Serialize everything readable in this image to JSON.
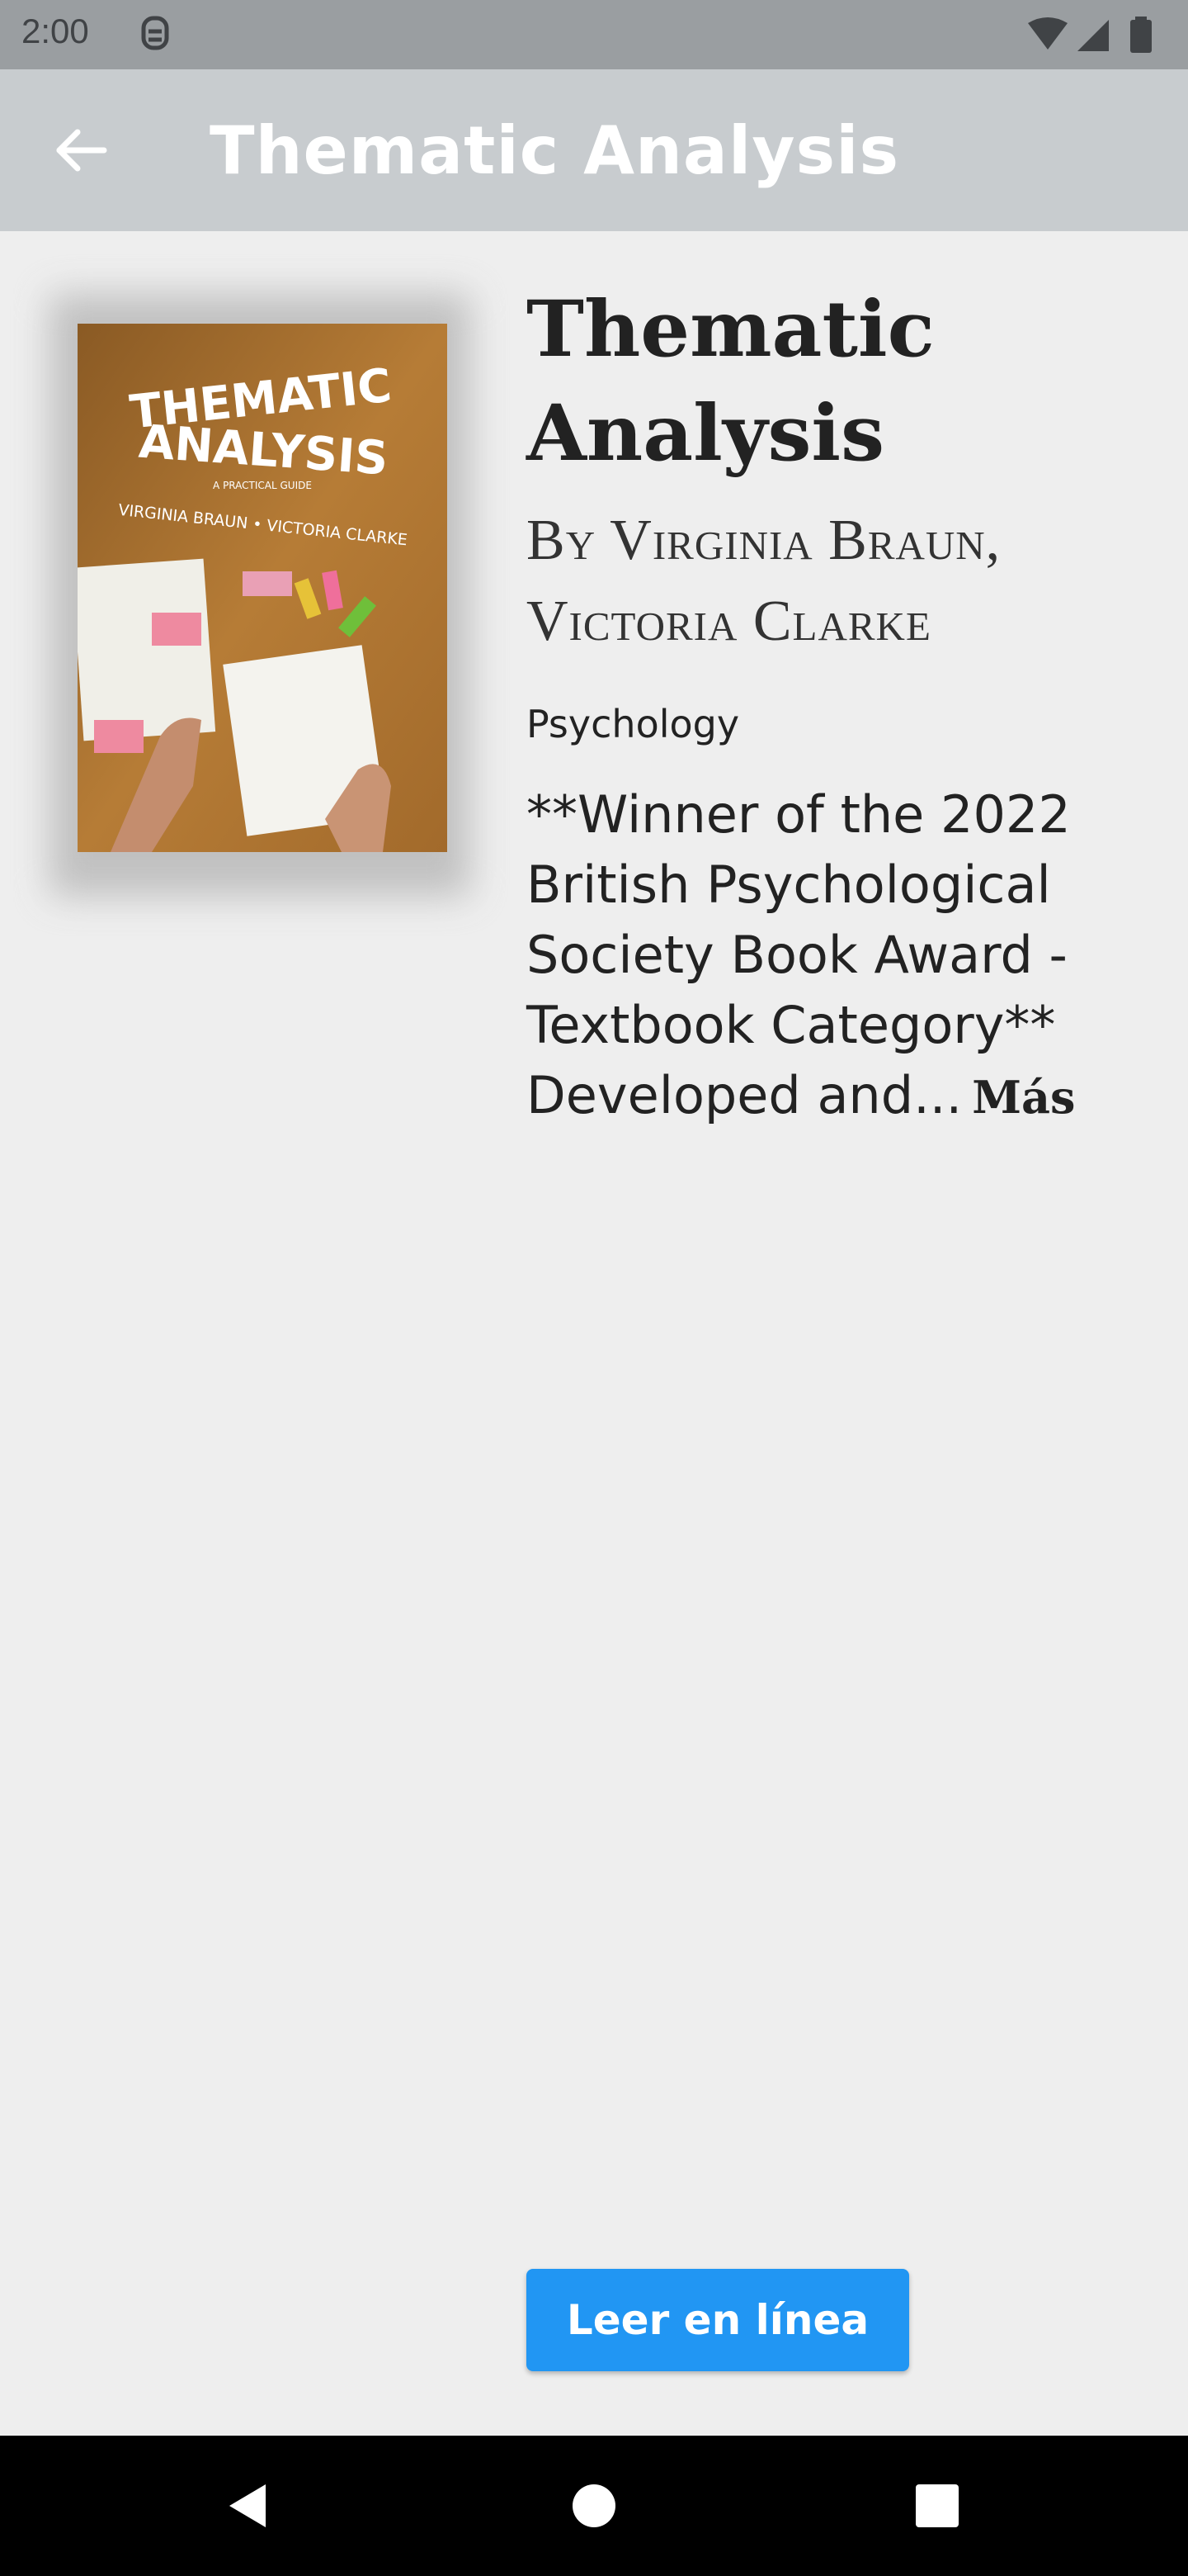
{
  "status_bar": {
    "time": "2:00",
    "notification_icon": "notification-icon",
    "icons": [
      "wifi-icon",
      "signal-icon",
      "battery-icon"
    ]
  },
  "app_bar": {
    "back_icon": "arrow-back-icon",
    "title": "Thematic Analysis"
  },
  "book": {
    "cover_alt": "Thematic Analysis cover",
    "cover_text": {
      "title_line1": "THEMATIC",
      "title_line2": "ANALYSIS",
      "subtitle": "A PRACTICAL GUIDE",
      "authors": "VIRGINIA BRAUN • VICTORIA CLARKE"
    },
    "title": "Thematic Analysis",
    "authors": "By Virginia Braun, Victoria Clarke",
    "category": "Psychology",
    "description": "**Winner of the 2022 British Psychological Society Book Award - Textbook Category** Developed and...",
    "more_label": "Más"
  },
  "actions": {
    "read_online_label": "Leer en línea"
  },
  "colors": {
    "accent": "#2196f3",
    "app_bar": "#c8cccf",
    "background": "#eeeeee",
    "status_bar": "#9a9ea1"
  },
  "nav_bar": {
    "icons": [
      "back-triangle-icon",
      "home-circle-icon",
      "recents-square-icon"
    ]
  }
}
